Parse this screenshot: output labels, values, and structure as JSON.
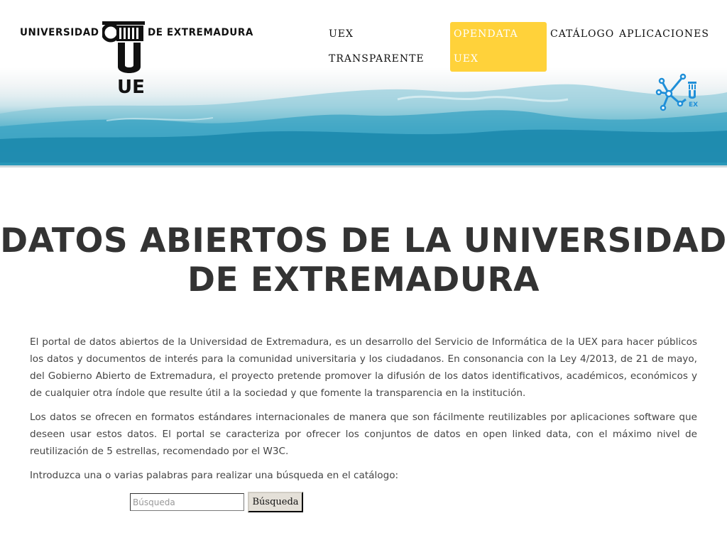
{
  "header": {
    "logo": {
      "left_text": "UNIVERSIDAD",
      "right_text": "DE EXTREMADURA",
      "mark_text": "UEX"
    },
    "nav": {
      "uex_transparente": "UEX TRANSPARENTE",
      "opendata_uex": "OPENDATA UEX",
      "catalogo": "CATÁLOGO",
      "aplicaciones": "APLICACIONES"
    },
    "badge_text": "EX",
    "colors": {
      "active_nav_bg": "#ffd23a",
      "water": "#2a9dbd",
      "badge": "#1f8fd8"
    }
  },
  "main": {
    "title": "DATOS ABIERTOS DE LA UNIVERSIDAD DE EXTREMADURA",
    "paragraph_1": "El portal de datos abiertos de la Universidad de Extremadura, es un desarrollo del Servicio de Informática de la UEX para hacer públicos los datos y documentos de interés para la comunidad universitaria y los ciudadanos. En consonancia con la Ley 4/2013, de 21 de mayo, del Gobierno Abierto de Extremadura, el proyecto pretende promover la difusión de los datos identificativos, académicos, económicos y de cualquier otra índole que resulte útil a la sociedad y que fomente la transparencia en la institución.",
    "paragraph_2": "Los datos se ofrecen en formatos estándares internacionales de manera que son fácilmente reutilizables por aplicaciones software que deseen usar estos datos. El portal se caracteriza por ofrecer los conjuntos de datos en open linked data, con el máximo nivel de reutilización de 5 estrellas, recomendado por el W3C.",
    "search_prompt": "Introduzca una o varias palabras para realizar una búsqueda en el catálogo:"
  },
  "search": {
    "placeholder": "Búsqueda",
    "value": "",
    "button_label": "Búsqueda"
  }
}
